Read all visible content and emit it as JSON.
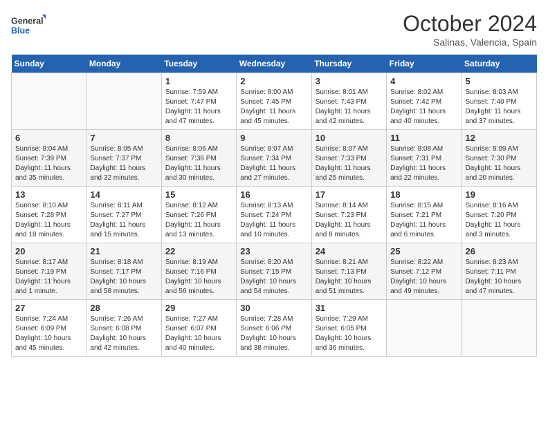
{
  "header": {
    "logo_general": "General",
    "logo_blue": "Blue",
    "month_title": "October 2024",
    "location": "Salinas, Valencia, Spain"
  },
  "weekdays": [
    "Sunday",
    "Monday",
    "Tuesday",
    "Wednesday",
    "Thursday",
    "Friday",
    "Saturday"
  ],
  "weeks": [
    [
      {
        "day": "",
        "detail": ""
      },
      {
        "day": "",
        "detail": ""
      },
      {
        "day": "1",
        "detail": "Sunrise: 7:59 AM\nSunset: 7:47 PM\nDaylight: 11 hours and 47 minutes."
      },
      {
        "day": "2",
        "detail": "Sunrise: 8:00 AM\nSunset: 7:45 PM\nDaylight: 11 hours and 45 minutes."
      },
      {
        "day": "3",
        "detail": "Sunrise: 8:01 AM\nSunset: 7:43 PM\nDaylight: 11 hours and 42 minutes."
      },
      {
        "day": "4",
        "detail": "Sunrise: 8:02 AM\nSunset: 7:42 PM\nDaylight: 11 hours and 40 minutes."
      },
      {
        "day": "5",
        "detail": "Sunrise: 8:03 AM\nSunset: 7:40 PM\nDaylight: 11 hours and 37 minutes."
      }
    ],
    [
      {
        "day": "6",
        "detail": "Sunrise: 8:04 AM\nSunset: 7:39 PM\nDaylight: 11 hours and 35 minutes."
      },
      {
        "day": "7",
        "detail": "Sunrise: 8:05 AM\nSunset: 7:37 PM\nDaylight: 11 hours and 32 minutes."
      },
      {
        "day": "8",
        "detail": "Sunrise: 8:06 AM\nSunset: 7:36 PM\nDaylight: 11 hours and 30 minutes."
      },
      {
        "day": "9",
        "detail": "Sunrise: 8:07 AM\nSunset: 7:34 PM\nDaylight: 11 hours and 27 minutes."
      },
      {
        "day": "10",
        "detail": "Sunrise: 8:07 AM\nSunset: 7:33 PM\nDaylight: 11 hours and 25 minutes."
      },
      {
        "day": "11",
        "detail": "Sunrise: 8:08 AM\nSunset: 7:31 PM\nDaylight: 11 hours and 22 minutes."
      },
      {
        "day": "12",
        "detail": "Sunrise: 8:09 AM\nSunset: 7:30 PM\nDaylight: 11 hours and 20 minutes."
      }
    ],
    [
      {
        "day": "13",
        "detail": "Sunrise: 8:10 AM\nSunset: 7:28 PM\nDaylight: 11 hours and 18 minutes."
      },
      {
        "day": "14",
        "detail": "Sunrise: 8:11 AM\nSunset: 7:27 PM\nDaylight: 11 hours and 15 minutes."
      },
      {
        "day": "15",
        "detail": "Sunrise: 8:12 AM\nSunset: 7:26 PM\nDaylight: 11 hours and 13 minutes."
      },
      {
        "day": "16",
        "detail": "Sunrise: 8:13 AM\nSunset: 7:24 PM\nDaylight: 11 hours and 10 minutes."
      },
      {
        "day": "17",
        "detail": "Sunrise: 8:14 AM\nSunset: 7:23 PM\nDaylight: 11 hours and 8 minutes."
      },
      {
        "day": "18",
        "detail": "Sunrise: 8:15 AM\nSunset: 7:21 PM\nDaylight: 11 hours and 6 minutes."
      },
      {
        "day": "19",
        "detail": "Sunrise: 8:16 AM\nSunset: 7:20 PM\nDaylight: 11 hours and 3 minutes."
      }
    ],
    [
      {
        "day": "20",
        "detail": "Sunrise: 8:17 AM\nSunset: 7:19 PM\nDaylight: 11 hours and 1 minute."
      },
      {
        "day": "21",
        "detail": "Sunrise: 8:18 AM\nSunset: 7:17 PM\nDaylight: 10 hours and 58 minutes."
      },
      {
        "day": "22",
        "detail": "Sunrise: 8:19 AM\nSunset: 7:16 PM\nDaylight: 10 hours and 56 minutes."
      },
      {
        "day": "23",
        "detail": "Sunrise: 8:20 AM\nSunset: 7:15 PM\nDaylight: 10 hours and 54 minutes."
      },
      {
        "day": "24",
        "detail": "Sunrise: 8:21 AM\nSunset: 7:13 PM\nDaylight: 10 hours and 51 minutes."
      },
      {
        "day": "25",
        "detail": "Sunrise: 8:22 AM\nSunset: 7:12 PM\nDaylight: 10 hours and 49 minutes."
      },
      {
        "day": "26",
        "detail": "Sunrise: 8:23 AM\nSunset: 7:11 PM\nDaylight: 10 hours and 47 minutes."
      }
    ],
    [
      {
        "day": "27",
        "detail": "Sunrise: 7:24 AM\nSunset: 6:09 PM\nDaylight: 10 hours and 45 minutes."
      },
      {
        "day": "28",
        "detail": "Sunrise: 7:26 AM\nSunset: 6:08 PM\nDaylight: 10 hours and 42 minutes."
      },
      {
        "day": "29",
        "detail": "Sunrise: 7:27 AM\nSunset: 6:07 PM\nDaylight: 10 hours and 40 minutes."
      },
      {
        "day": "30",
        "detail": "Sunrise: 7:28 AM\nSunset: 6:06 PM\nDaylight: 10 hours and 38 minutes."
      },
      {
        "day": "31",
        "detail": "Sunrise: 7:29 AM\nSunset: 6:05 PM\nDaylight: 10 hours and 36 minutes."
      },
      {
        "day": "",
        "detail": ""
      },
      {
        "day": "",
        "detail": ""
      }
    ]
  ]
}
